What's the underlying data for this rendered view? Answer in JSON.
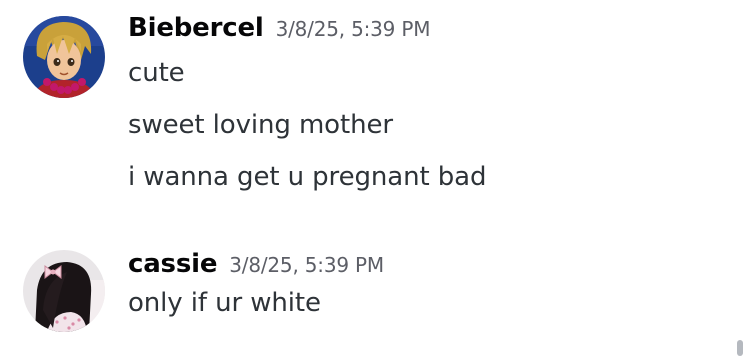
{
  "messages": [
    {
      "username": "Biebercel",
      "timestamp": "3/8/25, 5:39 PM",
      "avatar_icon": "anime-boy-avatar",
      "lines": [
        "cute",
        "sweet loving mother",
        "i wanna get u pregnant bad"
      ]
    },
    {
      "username": "cassie",
      "timestamp": "3/8/25, 5:39 PM",
      "avatar_icon": "girl-with-bow-avatar",
      "lines": [
        "only if ur white"
      ]
    }
  ],
  "colors": {
    "background": "#ffffff",
    "username": "#060607",
    "timestamp": "#5c5e66",
    "message_text": "#2e3338",
    "scrollbar": "#b5b9bf"
  }
}
